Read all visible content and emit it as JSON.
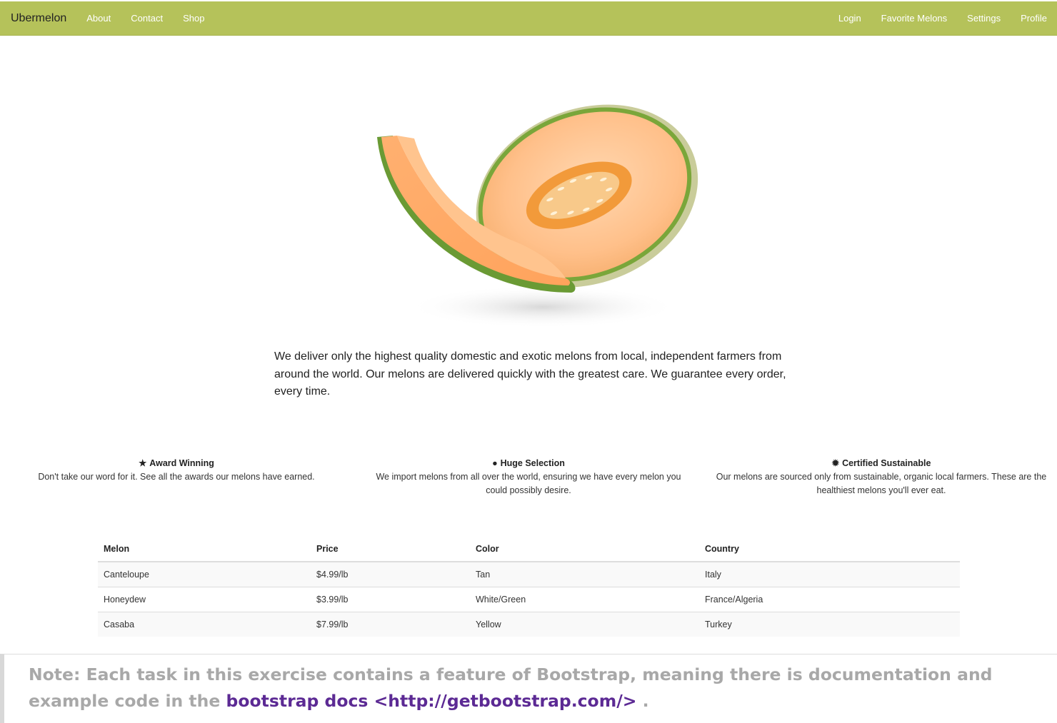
{
  "navbar": {
    "brand": "Ubermelon",
    "left_links": [
      "About",
      "Contact",
      "Shop"
    ],
    "right_links": [
      "Login",
      "Favorite Melons",
      "Settings",
      "Profile"
    ],
    "color": "#b5c25a"
  },
  "intro": "We deliver only the highest quality domestic and exotic melons from local, independent farmers from around the world. Our melons are delivered quickly with the greatest care. We guarantee every order, every time.",
  "features": [
    {
      "icon": "star-icon",
      "glyph": "★",
      "title": "Award Winning",
      "description": "Don't take our word for it. See all the awards our melons have earned."
    },
    {
      "icon": "globe-icon",
      "glyph": "●",
      "title": "Huge Selection",
      "description": "We import melons from all over the world, ensuring we have every melon you could possibly desire."
    },
    {
      "icon": "certificate-icon",
      "glyph": "✹",
      "title": "Certified Sustainable",
      "description": "Our melons are sourced only from sustainable, organic local farmers. These are the healthiest melons you'll ever eat."
    }
  ],
  "table": {
    "headers": [
      "Melon",
      "Price",
      "Color",
      "Country"
    ],
    "rows": [
      [
        "Canteloupe",
        "$4.99/lb",
        "Tan",
        "Italy"
      ],
      [
        "Honeydew",
        "$3.99/lb",
        "White/Green",
        "France/Algeria"
      ],
      [
        "Casaba",
        "$7.99/lb",
        "Yellow",
        "Turkey"
      ]
    ]
  },
  "note": {
    "prefix": "Note: Each task in this exercise contains a feature of Bootstrap, meaning there is documentation and example code in the",
    "link_text": "bootstrap docs <http://getbootstrap.com/>",
    "suffix": "."
  }
}
